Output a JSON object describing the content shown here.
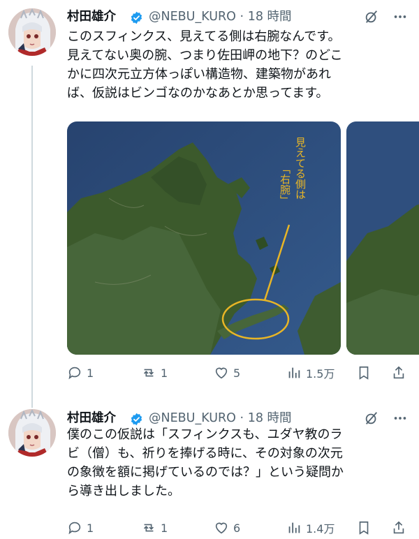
{
  "tweets": [
    {
      "author": "村田雄介",
      "handle": "@NEBU_KURO",
      "time": "18 時間",
      "lines": [
        "このスフィンクス、見えてる側は右腕なんです。",
        "見えてない奥の腕、つまり佐田岬の地下？のどこ",
        "かに四次元立方体っぽい構造物、建築物があれ",
        "ば、仮説はビンゴなのかなあとか思ってます。"
      ],
      "annotation": [
        "見えてる側は",
        "「右腕」"
      ],
      "replies": "1",
      "retweets": "1",
      "likes": "5",
      "views": "1.5万"
    },
    {
      "author": "村田雄介",
      "handle": "@NEBU_KURO",
      "time": "18 時間",
      "lines": [
        "僕のこの仮説は「スフィンクスも、ユダヤ教のラ",
        "ビ（僧）も、祈りを捧げる時に、その対象の次元",
        "の象徴を額に掲げているのでは？」という疑問か",
        "ら導き出しました。"
      ],
      "replies": "1",
      "retweets": "1",
      "likes": "6",
      "views": "1.4万"
    }
  ],
  "icons": {
    "verified": "verified-badge-icon",
    "grok": "grok-icon",
    "more": "more-icon",
    "reply": "reply-icon",
    "retweet": "retweet-icon",
    "like": "heart-icon",
    "views": "views-icon",
    "bookmark": "bookmark-icon",
    "share": "share-icon"
  },
  "colors": {
    "accent": "#1d9bf0",
    "secondary_text": "#536471",
    "annotation": "#e8b526"
  }
}
